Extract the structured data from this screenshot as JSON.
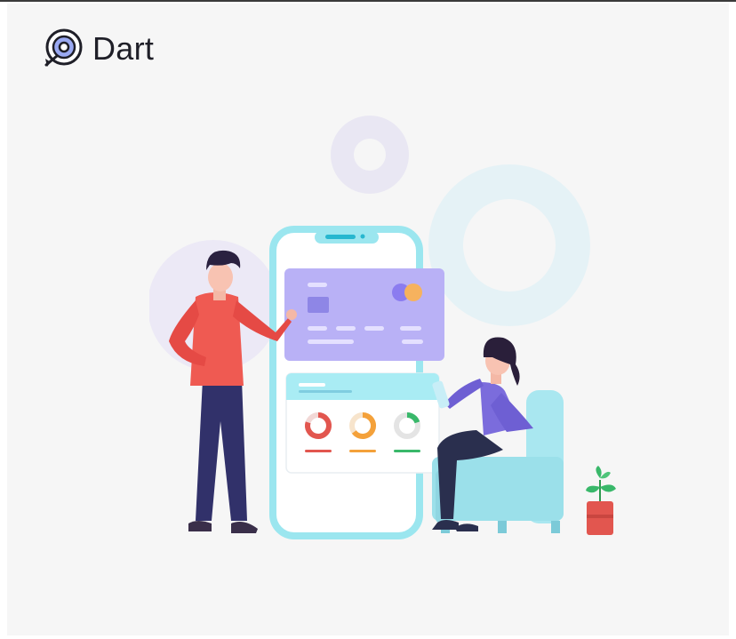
{
  "brand": {
    "name": "Dart",
    "logo_icon": "dart-target-icon",
    "accent_color": "#3b3b9a"
  },
  "illustration": {
    "icon": "finance-app-illustration",
    "colors": {
      "card": "#b9b1f6",
      "phone_frame": "#9be6ef",
      "chair": "#a9e7f0",
      "man_shirt": "#ef5a52",
      "woman_shirt": "#7b6cdc",
      "ring_red": "#e2564f",
      "ring_orange": "#f4a13a",
      "ring_green": "#39b86a"
    }
  }
}
